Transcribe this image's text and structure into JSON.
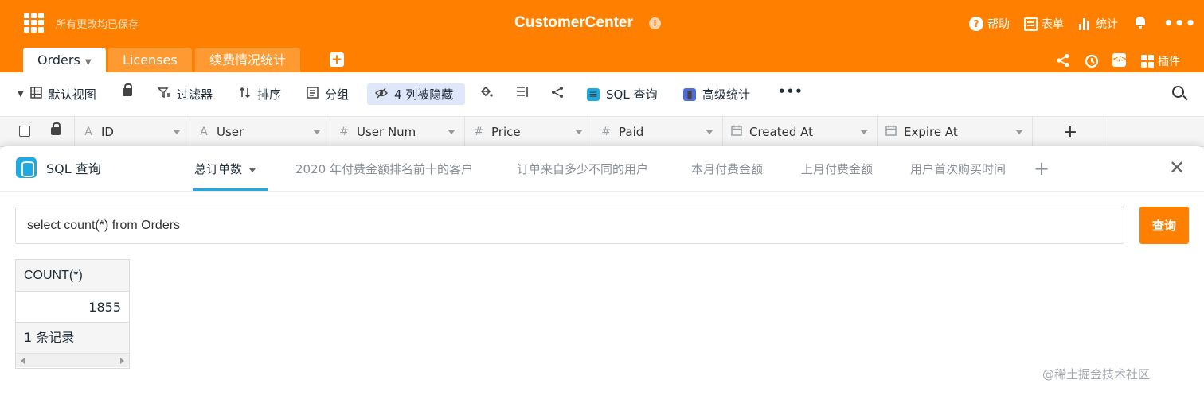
{
  "header": {
    "saved_status": "所有更改均已保存",
    "app_title": "CustomerCenter",
    "info_glyph": "i",
    "help_label": "帮助",
    "form_label": "表单",
    "stats_label": "统计",
    "more_glyph": "•••",
    "accent_color": "#ff8000"
  },
  "tabs": {
    "items": [
      {
        "label": "Orders"
      },
      {
        "label": "Licenses"
      },
      {
        "label": "续费情况统计"
      }
    ],
    "add_glyph": "+",
    "plugins_label": "插件"
  },
  "toolbar": {
    "view_label": "默认视图",
    "filter_label": "过滤器",
    "sort_label": "排序",
    "group_label": "分组",
    "hidden_label": "4 列被隐藏",
    "sql_label": "SQL 查询",
    "advanced_stats_label": "高级统计",
    "more_glyph": "•••"
  },
  "columns": [
    {
      "type_icon": "A",
      "name": "ID"
    },
    {
      "type_icon": "A",
      "name": "User"
    },
    {
      "type_icon": "#",
      "name": "User Num"
    },
    {
      "type_icon": "#",
      "name": "Price"
    },
    {
      "type_icon": "#",
      "name": "Paid"
    },
    {
      "type_icon": "calendar",
      "name": "Created At"
    },
    {
      "type_icon": "calendar",
      "name": "Expire At"
    }
  ],
  "add_column_glyph": "+",
  "sql_panel": {
    "title": "SQL 查询",
    "query_tabs": [
      {
        "label": "总订单数",
        "active": true
      },
      {
        "label": "2020 年付费金额排名前十的客户"
      },
      {
        "label": "订单来自多少不同的用户"
      },
      {
        "label": "本月付费金额"
      },
      {
        "label": "上月付费金额"
      },
      {
        "label": "用户首次购买时间"
      }
    ],
    "add_query_glyph": "+",
    "close_glyph": "✕",
    "query_value": "select count(*) from Orders",
    "run_label": "查询",
    "result": {
      "column_header": "COUNT(*)",
      "value": "1855",
      "record_count_label": "1 条记录"
    }
  },
  "watermark": "@稀土掘金技术社区"
}
